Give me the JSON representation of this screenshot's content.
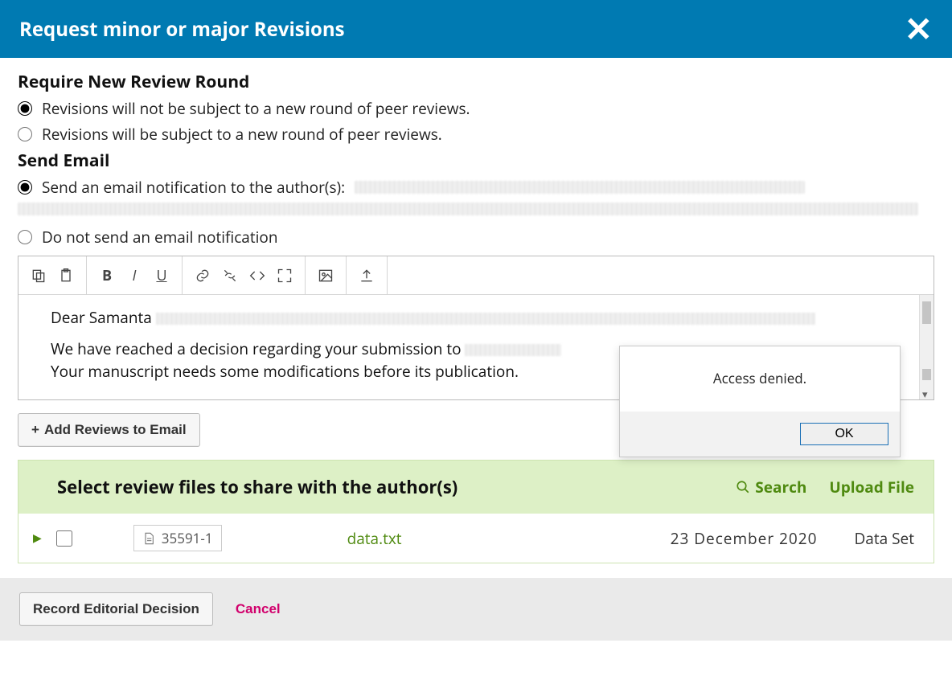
{
  "header": {
    "title": "Request minor or major Revisions"
  },
  "reviewRound": {
    "heading": "Require New Review Round",
    "optNoNew": "Revisions will not be subject to a new round of peer reviews.",
    "optNew": "Revisions will be subject to a new round of peer reviews."
  },
  "sendEmail": {
    "heading": "Send Email",
    "optSend": "Send an email notification to the author(s): ",
    "optNoSend": "Do not send an email notification"
  },
  "editor": {
    "greeting": "Dear Samanta ",
    "line1a": "We have reached a decision regarding your submission to ",
    "line2": "Your manuscript needs some modifications before its publication."
  },
  "buttons": {
    "addReviews": "Add Reviews to Email",
    "record": "Record Editorial Decision",
    "cancel": "Cancel"
  },
  "files": {
    "heading": "Select review files to share with the author(s)",
    "search": "Search",
    "upload": "Upload File",
    "row": {
      "id": "35591-1",
      "name": "data.txt",
      "date": "23  December  2020",
      "type": "Data Set"
    }
  },
  "popup": {
    "message": "Access denied.",
    "ok": "OK"
  }
}
